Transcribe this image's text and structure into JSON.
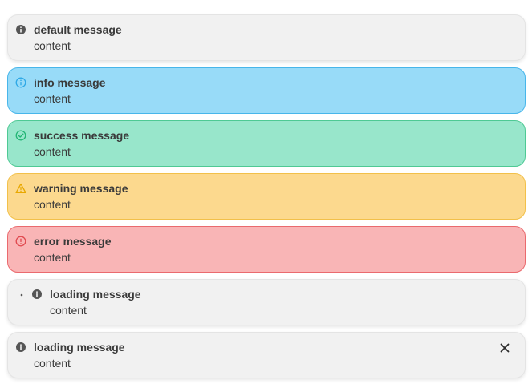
{
  "toasts": [
    {
      "type": "default",
      "icon": "info-icon",
      "title": "default message",
      "content": "content"
    },
    {
      "type": "info",
      "icon": "info-icon",
      "title": "info message",
      "content": "content"
    },
    {
      "type": "success",
      "icon": "check-circle-icon",
      "title": "success message",
      "content": "content"
    },
    {
      "type": "warning",
      "icon": "warning-triangle-icon",
      "title": "warning message",
      "content": "content"
    },
    {
      "type": "error",
      "icon": "error-circle-icon",
      "title": "error message",
      "content": "content"
    },
    {
      "type": "loading",
      "icon": "info-icon",
      "title": "loading message",
      "content": "content"
    },
    {
      "type": "closable",
      "icon": "info-icon",
      "title": "loading message",
      "content": "content",
      "close_icon": "close-icon"
    }
  ],
  "colors": {
    "default_bg": "#f1f1f1",
    "info_bg": "#98dbf8",
    "info_accent": "#2ea8e6",
    "success_bg": "#98e6cb",
    "success_accent": "#22b573",
    "warning_bg": "#fcd98e",
    "warning_accent": "#e8a800",
    "error_bg": "#f9b5b6",
    "error_accent": "#e0484e",
    "text": "#3a3a3a"
  }
}
